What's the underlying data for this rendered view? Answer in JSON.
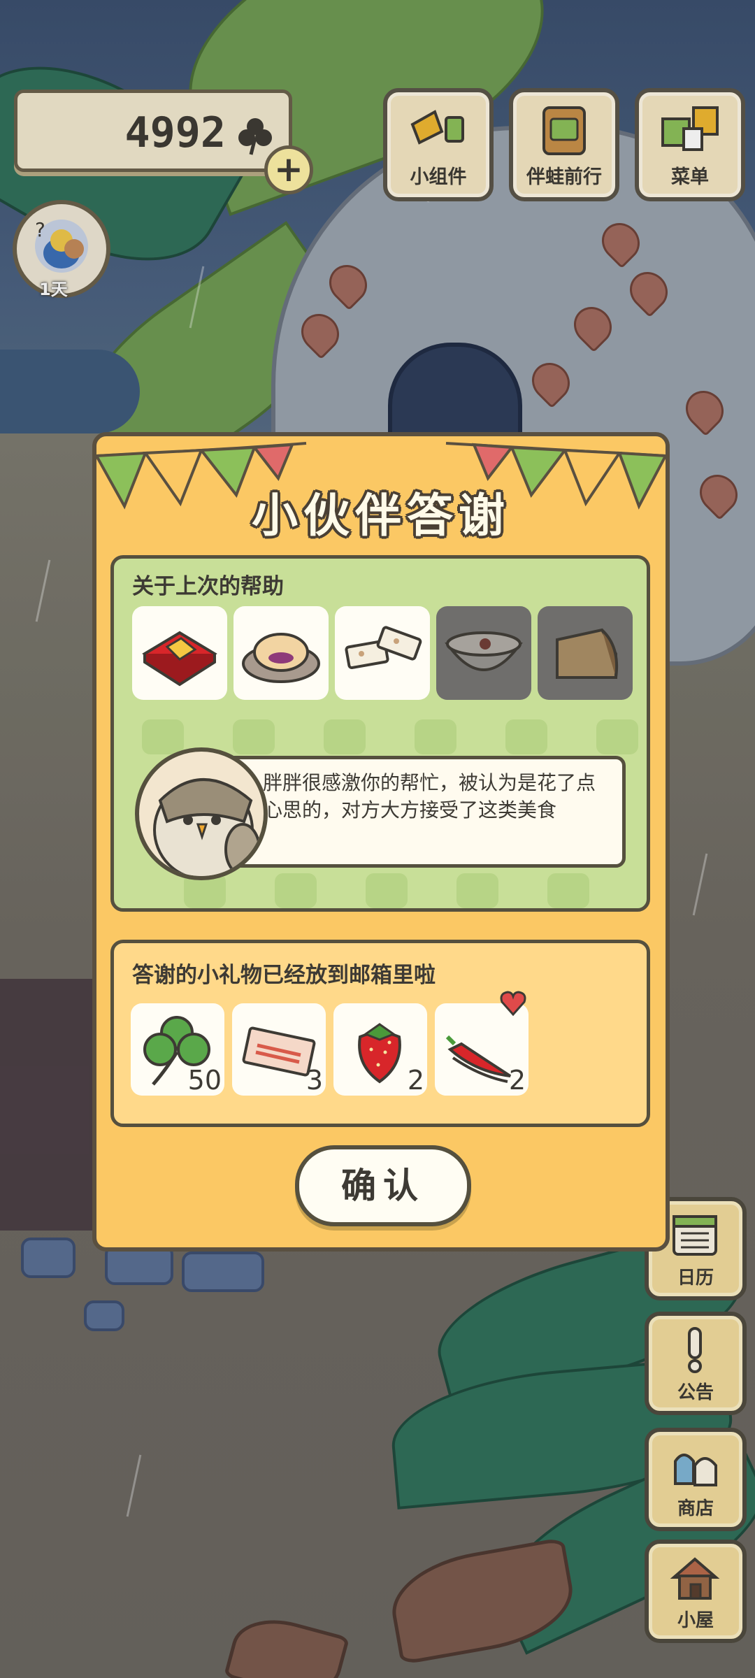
{
  "hud": {
    "clover_count": "4992",
    "status_day": "1天",
    "top_buttons": [
      {
        "label": "小组件",
        "icon": "widget-icon"
      },
      {
        "label": "伴蛙前行",
        "icon": "frog-journey-icon"
      },
      {
        "label": "菜单",
        "icon": "menu-icon"
      }
    ],
    "side_buttons": [
      {
        "label": "日历",
        "icon": "calendar-icon"
      },
      {
        "label": "公告",
        "icon": "notice-icon"
      },
      {
        "label": "商店",
        "icon": "shop-icon"
      },
      {
        "label": "小屋",
        "icon": "house-icon"
      }
    ]
  },
  "dialog": {
    "title": "小伙伴答谢",
    "help_section": {
      "title": "关于上次的帮助",
      "items": [
        {
          "icon": "mooncake-gift-box-icon",
          "state": "given"
        },
        {
          "icon": "purple-cake-plate-icon",
          "state": "given"
        },
        {
          "icon": "nougat-candy-icon",
          "state": "given"
        },
        {
          "icon": "porridge-bowl-icon",
          "state": "dimmed"
        },
        {
          "icon": "cheese-wedge-icon",
          "state": "dimmed"
        }
      ]
    },
    "message": "胖胖很感激你的帮忙，被认为是花了点心思的，对方大方接受了这类美食",
    "gift_section": {
      "title": "答谢的小礼物已经放到邮箱里啦",
      "gifts": [
        {
          "icon": "clover-icon",
          "quantity": "50"
        },
        {
          "icon": "ticket-icon",
          "quantity": "3"
        },
        {
          "icon": "strawberry-icon",
          "quantity": "2"
        },
        {
          "icon": "chili-pepper-icon",
          "quantity": "2"
        }
      ]
    },
    "confirm_label": "确认"
  },
  "colors": {
    "dialog_bg": "#fbc864",
    "help_panel_bg": "#c8df98",
    "gift_panel_bg": "#ffd98a",
    "outline": "#55503e"
  }
}
